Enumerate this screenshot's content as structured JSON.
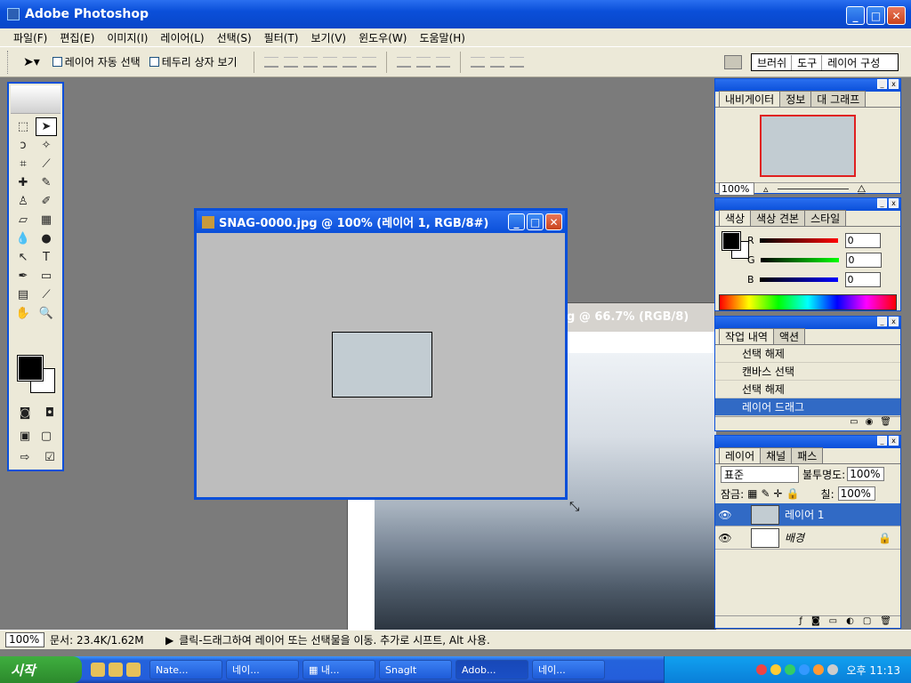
{
  "window": {
    "title": "Adobe Photoshop"
  },
  "menu": [
    "파일(F)",
    "편집(E)",
    "이미지(I)",
    "레이어(L)",
    "선택(S)",
    "필터(T)",
    "보기(V)",
    "윈도우(W)",
    "도움말(H)"
  ],
  "options": {
    "auto_select": "레이어 자동 선택",
    "bounding_box": "테두리 상자 보기",
    "palette_well": [
      "브러쉬",
      "도구",
      "레이어 구성"
    ]
  },
  "doc_front": {
    "title": "SNAG-0000.jpg @ 100% (레이어 1, RGB/8#)"
  },
  "doc_back": {
    "title": "g @ 66.7% (RGB/8)"
  },
  "navigator": {
    "tabs": [
      "내비게이터",
      "정보",
      "대 그래프"
    ],
    "zoom": "100%"
  },
  "color": {
    "tabs": [
      "색상",
      "색상 견본",
      "스타일"
    ],
    "r_label": "R",
    "g_label": "G",
    "b_label": "B",
    "r": "0",
    "g": "0",
    "b": "0"
  },
  "history": {
    "tabs": [
      "작업 내역",
      "액션"
    ],
    "items": [
      "선택 해제",
      "캔바스 선택",
      "선택 해제",
      "레이어 드래그"
    ]
  },
  "layers": {
    "tabs": [
      "레이어",
      "채널",
      "패스"
    ],
    "mode": "표준",
    "opacity_label": "불투명도:",
    "opacity": "100%",
    "lock_label": "잠금:",
    "fill_label": "칠:",
    "fill": "100%",
    "rows": [
      "레이어 1",
      "배경"
    ]
  },
  "status": {
    "zoom": "100%",
    "doc": "문서: 23.4K/1.62M",
    "hint": "클릭-드래그하여 레이어 또는 선택물을 이동. 추가로 시프트, Alt 사용."
  },
  "taskbar": {
    "start": "시작",
    "tasks": [
      "Nate...",
      "네이...",
      "▦ 내...",
      "SnagIt",
      "Adob...",
      "네이..."
    ],
    "clock": "오후 11:13"
  }
}
